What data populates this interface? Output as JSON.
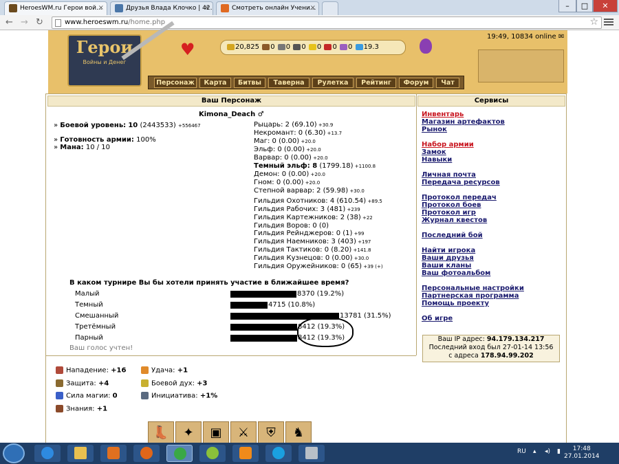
{
  "browser": {
    "tabs": [
      {
        "label": "HeroesWM.ru Герои вой..."
      },
      {
        "label": "Друзья Влада Клочко | 42..."
      },
      {
        "label": "Смотреть онлайн Учени..."
      }
    ],
    "url_host": "www.heroeswm.ru",
    "url_path": "/home.php"
  },
  "header": {
    "logo_title": "Герои",
    "logo_subtitle": "Войны и Денег",
    "resources": [
      "20,825",
      "0",
      "0",
      "0",
      "0",
      "0",
      "0",
      "19.3"
    ],
    "online": "19:49, 10834 online",
    "nav": [
      "Персонаж",
      "Карта",
      "Битвы",
      "Таверна",
      "Рулетка",
      "Рейтинг",
      "Форум",
      "Чат"
    ]
  },
  "left_panel": {
    "title": "Ваш Персонаж",
    "char_name": "Kimona_Deach",
    "level_label": "Боевой уровень:",
    "level_value": "10",
    "level_exp": "(2443533)",
    "level_next": "+556467",
    "army_label": "Готовность армии:",
    "army_value": "100%",
    "mana_label": "Мана:",
    "mana_value": "10 / 10",
    "skills": [
      {
        "text": "Рыцарь: 2 (69.10)",
        "small": "+30.9"
      },
      {
        "text": "Некромант: 0 (6.30)",
        "small": "+13.7"
      },
      {
        "text": "Маг: 0 (0.00)",
        "small": "+20.0"
      },
      {
        "text": "Эльф: 0 (0.00)",
        "small": "+20.0"
      },
      {
        "text": "Варвар: 0 (0.00)",
        "small": "+20.0"
      },
      {
        "bold": "Темный эльф: 8",
        "text": " (1799.18)",
        "small": "+1100.8"
      },
      {
        "text": "Демон: 0 (0.00)",
        "small": "+20.0"
      },
      {
        "text": "Гном: 0 (0.00)",
        "small": "+20.0"
      },
      {
        "text": "Степной варвар: 2 (59.98)",
        "small": "+30.0"
      }
    ],
    "guilds": [
      {
        "text": "Гильдия Охотников: 4 (610.54)",
        "small": "+89.5"
      },
      {
        "text": "Гильдия Рабочих: 3 (481)",
        "small": "+239"
      },
      {
        "text": "Гильдия Картежников: 2 (38)",
        "small": "+22"
      },
      {
        "text": "Гильдия Воров: 0 (0)",
        "small": ""
      },
      {
        "text": "Гильдия Рейнджеров: 0 (1)",
        "small": "+99"
      },
      {
        "text": "Гильдия Наемников: 3 (403)",
        "small": "+197"
      },
      {
        "text": "Гильдия Тактиков: 0 (8.20)",
        "small": "+141.8"
      },
      {
        "text": "Гильдия Кузнецов: 0 (0.00)",
        "small": "+30.0"
      },
      {
        "text": "Гильдия Оружейников: 0 (65)",
        "small": "+39 (+)"
      }
    ],
    "poll_question": "В каком турнире Вы бы хотели принять участие в ближайшее время?",
    "poll_options": [
      {
        "label": "Малый",
        "votes": "8370 (19.2%)",
        "share": 19.2
      },
      {
        "label": "Темный",
        "votes": "4715 (10.8%)",
        "share": 10.8
      },
      {
        "label": "Смешанный",
        "votes": "13781 (31.5%)",
        "share": 31.5
      },
      {
        "label": "Третёмный",
        "votes": "8412 (19.3%)",
        "share": 19.3
      },
      {
        "label": "Парный",
        "votes": "8412 (19.3%)",
        "share": 19.3
      }
    ],
    "poll_voted": "Ваш голос учтен!",
    "attributes": [
      {
        "label": "Нападение:",
        "value": "+16"
      },
      {
        "label": "Защита:",
        "value": "+4"
      },
      {
        "label": "Сила магии:",
        "value": "0"
      },
      {
        "label": "Знания:",
        "value": "+1"
      },
      {
        "label": "Удача:",
        "value": "+1"
      },
      {
        "label": "Боевой дух:",
        "value": "+3"
      },
      {
        "label": "Инициатива:",
        "value": "+1%"
      }
    ]
  },
  "services": {
    "title": "Сервисы",
    "groups": [
      [
        {
          "label": "Инвентарь",
          "red": true
        },
        {
          "label": "Магазин артефактов"
        },
        {
          "label": "Рынок"
        }
      ],
      [
        {
          "label": "Набор армии",
          "red": true
        },
        {
          "label": "Замок"
        },
        {
          "label": "Навыки"
        }
      ],
      [
        {
          "label": "Личная почта"
        },
        {
          "label": "Передача ресурсов"
        }
      ],
      [
        {
          "label": "Протокол передач"
        },
        {
          "label": "Протокол боев"
        },
        {
          "label": "Протокол игр"
        },
        {
          "label": "Журнал квестов"
        }
      ],
      [
        {
          "label": "Последний бой"
        }
      ],
      [
        {
          "label": "Найти игрока"
        },
        {
          "label": "Ваши друзья"
        },
        {
          "label": "Ваши кланы"
        },
        {
          "label": "Ваш фотоальбом"
        }
      ],
      [
        {
          "label": "Персональные настройки"
        },
        {
          "label": "Партнерская программа"
        },
        {
          "label": "Помощь проекту"
        }
      ],
      [
        {
          "label": "Об игре"
        }
      ]
    ],
    "ip_label": "Ваш IP адрес:",
    "ip_value": "94.179.134.217",
    "last_login_label": "Последний вход был",
    "last_login_value": "27-01-14 13:56",
    "from_label": "с адреса",
    "from_value": "178.94.99.202"
  },
  "taskbar": {
    "lang": "RU",
    "time": "17:48",
    "date": "27.01.2014"
  }
}
